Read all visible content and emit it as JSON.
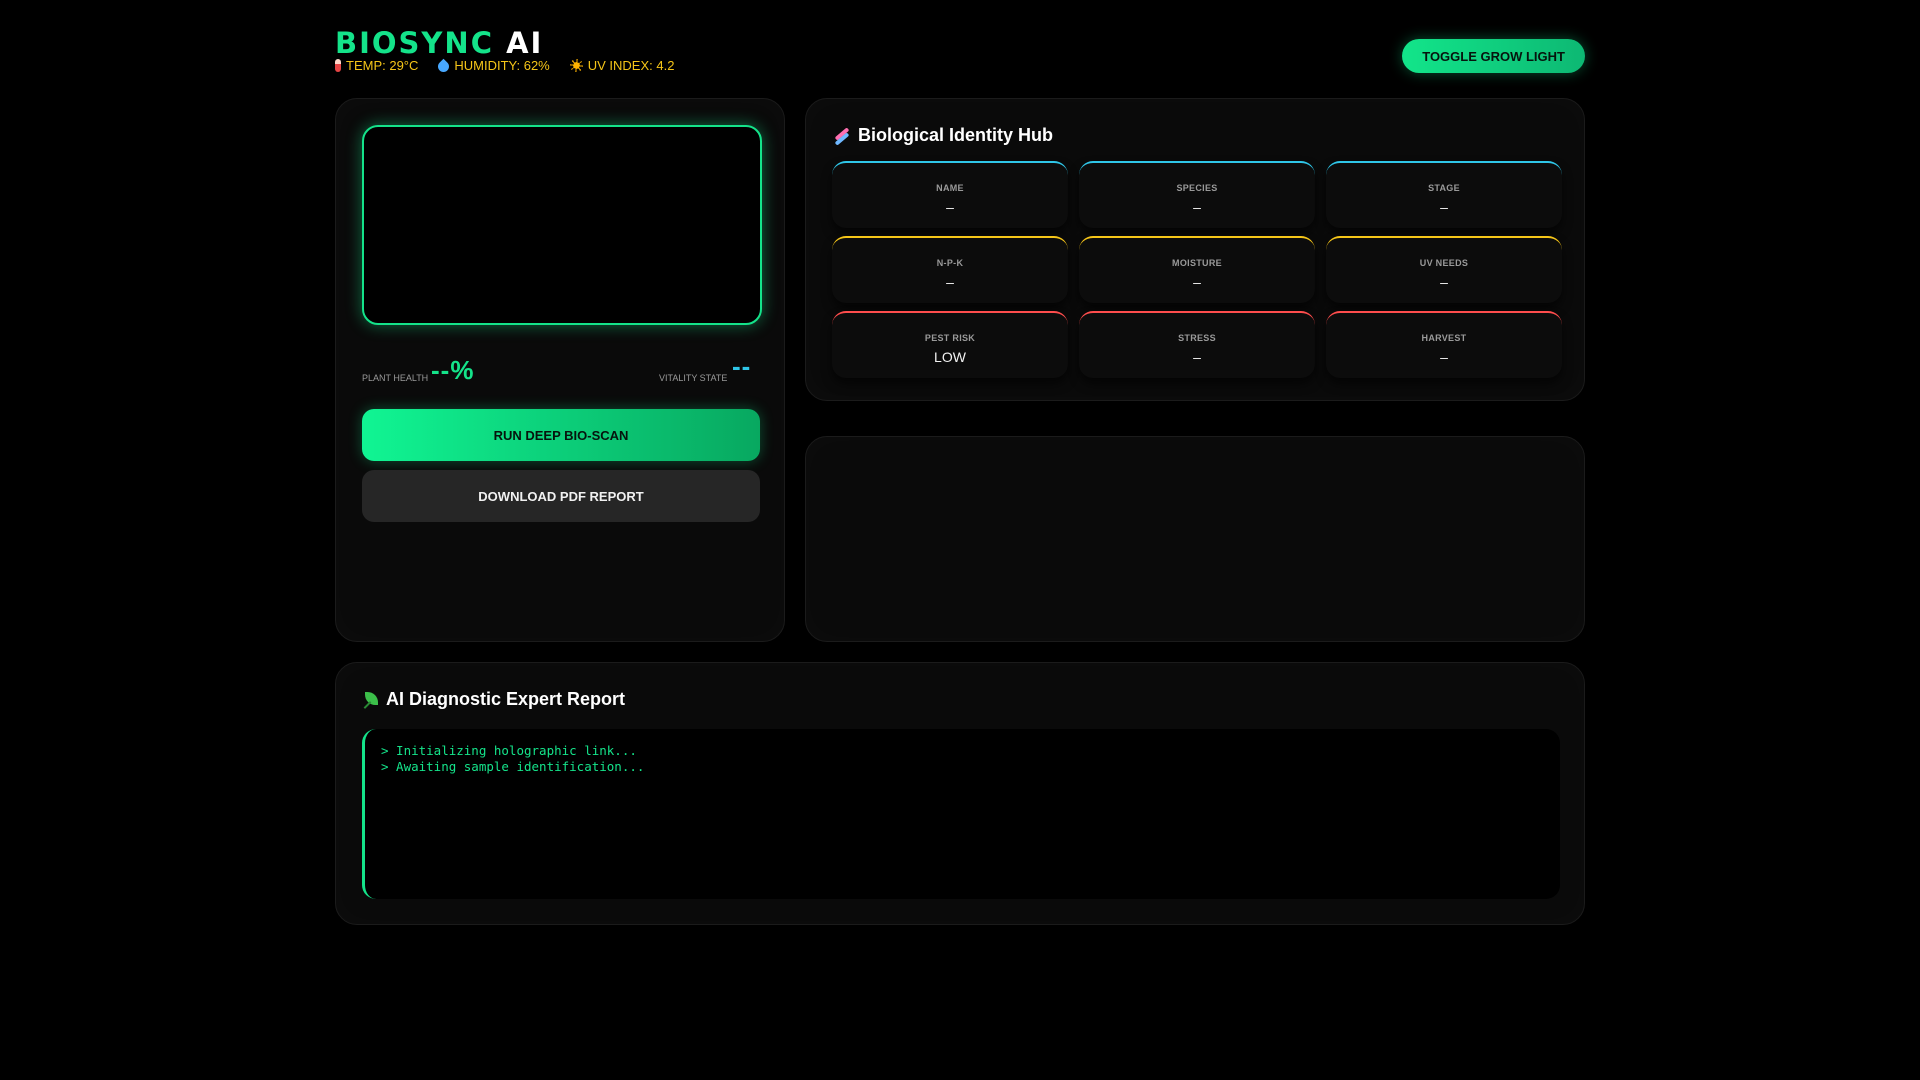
{
  "header": {
    "brand_primary": "BIOSYNC",
    "brand_secondary": "AI",
    "env": [
      {
        "icon": "thermometer-icon",
        "label": "TEMP: 29°C"
      },
      {
        "icon": "droplet-icon",
        "label": "HUMIDITY: 62%"
      },
      {
        "icon": "sun-icon",
        "label": "UV INDEX: 4.2"
      }
    ],
    "toggle_label": "TOGGLE GROW LIGHT"
  },
  "scanner": {
    "health_label": "PLANT HEALTH",
    "health_value": "--%",
    "vitality_label": "VITALITY STATE",
    "vitality_value": "--",
    "scan_button": "RUN DEEP BIO-SCAN",
    "pdf_button": "DOWNLOAD PDF REPORT"
  },
  "hub": {
    "title": "Biological Identity Hub",
    "cells": [
      {
        "label": "NAME",
        "value": "–"
      },
      {
        "label": "SPECIES",
        "value": "–"
      },
      {
        "label": "STAGE",
        "value": "–"
      },
      {
        "label": "N-P-K",
        "value": "–"
      },
      {
        "label": "MOISTURE",
        "value": "–"
      },
      {
        "label": "UV NEEDS",
        "value": "–"
      },
      {
        "label": "PEST RISK",
        "value": "LOW"
      },
      {
        "label": "STRESS",
        "value": "–"
      },
      {
        "label": "HARVEST",
        "value": "–"
      }
    ]
  },
  "report": {
    "title": "AI Diagnostic Expert Report",
    "lines": [
      "> Initializing holographic link...",
      "> Awaiting sample identification..."
    ]
  },
  "colors": {
    "accent_green": "#14e38a",
    "accent_cyan": "#2fc6e8",
    "accent_yellow": "#f5c518",
    "accent_red": "#ff4d4d"
  }
}
